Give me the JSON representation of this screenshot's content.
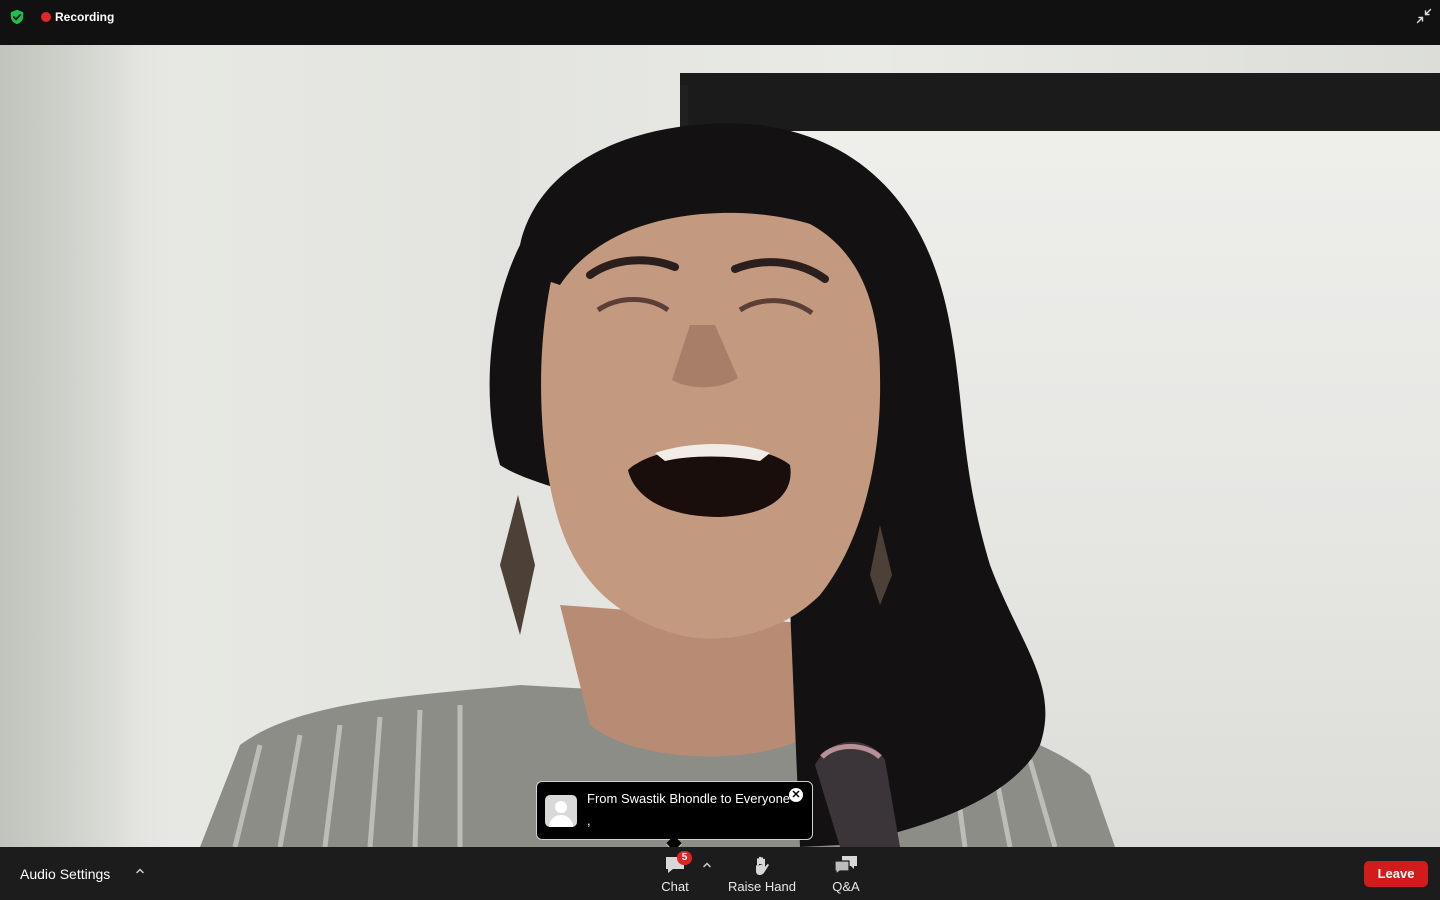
{
  "topbar": {
    "recording_label": "Recording",
    "icons": [
      "shield-check-icon",
      "recording-dot-icon",
      "exit-fullscreen-icon"
    ]
  },
  "chat_toast": {
    "from": "From Swastik Bhondle to Everyone",
    "message": ","
  },
  "toolbar": {
    "audio_settings_label": "Audio Settings",
    "chat_label": "Chat",
    "chat_badge": "5",
    "raise_hand_label": "Raise Hand",
    "qa_label": "Q&A",
    "leave_label": "Leave"
  },
  "colors": {
    "leave": "#d21b1b",
    "badge": "#e02424",
    "recording": "#e02828",
    "shield": "#1fbf4f"
  }
}
